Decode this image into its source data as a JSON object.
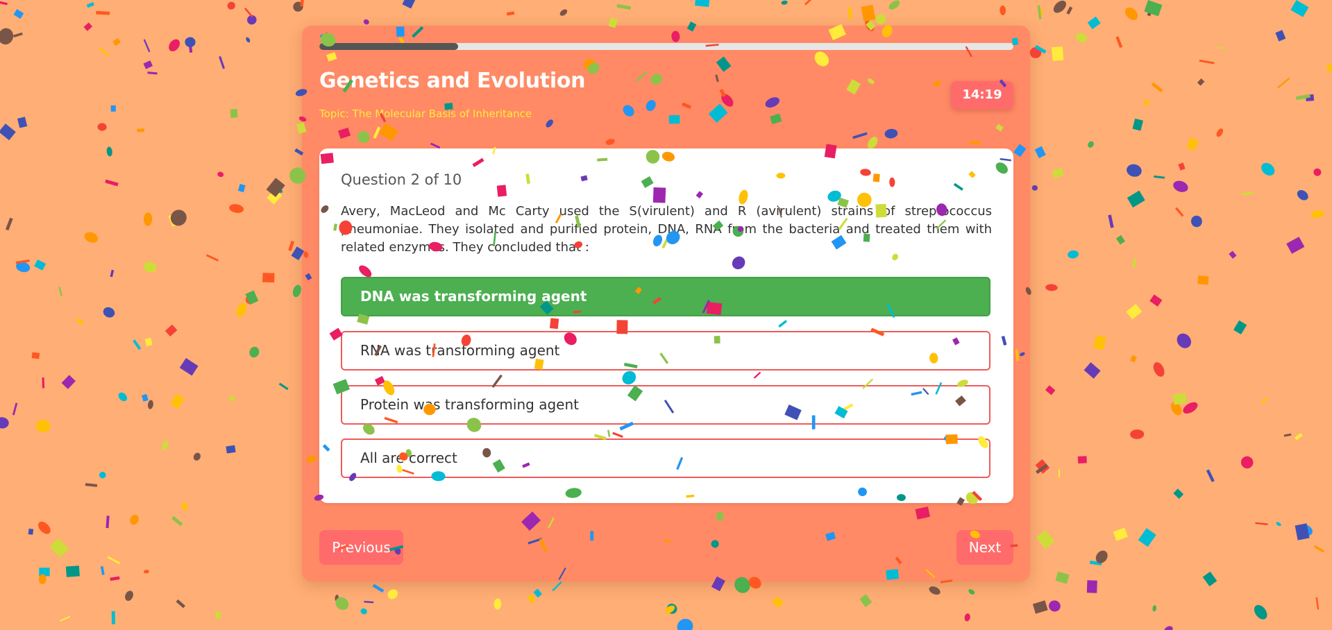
{
  "quiz": {
    "title": "Genetics and Evolution",
    "topic": "Topic: The Molecular Basis of Inheritance",
    "timer": "14:19",
    "progress": 0.2
  },
  "question": {
    "number_label": "Question 2 of 10",
    "text": "Avery, MacLeod and Mc Carty used the S(virulent) and R (avirulent) strains of streptococcus pneumoniae. They isolated and purified protein, DNA, RNA from the bacteria and treated them with related enzymes. They concluded that :",
    "options": [
      {
        "label": "DNA was transforming agent",
        "state": "correct"
      },
      {
        "label": "RNA was transforming agent",
        "state": "default"
      },
      {
        "label": "Protein was transforming agent",
        "state": "default"
      },
      {
        "label": "All are correct",
        "state": "default"
      }
    ]
  },
  "navigation": {
    "previous_label": "Previous",
    "next_label": "Next"
  },
  "colors": {
    "page_background": "#ffae75",
    "card_background": "#ff8a65",
    "accent": "#ff6b6b",
    "correct": "#4caf50",
    "topic": "#ffeb3b",
    "confetti": [
      "#f44336",
      "#e91e63",
      "#9c27b0",
      "#673ab7",
      "#3f51b5",
      "#2196f3",
      "#00bcd4",
      "#009688",
      "#4caf50",
      "#8bc34a",
      "#cddc39",
      "#ffeb3b",
      "#ffc107",
      "#ff9800",
      "#ff5722",
      "#795548"
    ]
  }
}
